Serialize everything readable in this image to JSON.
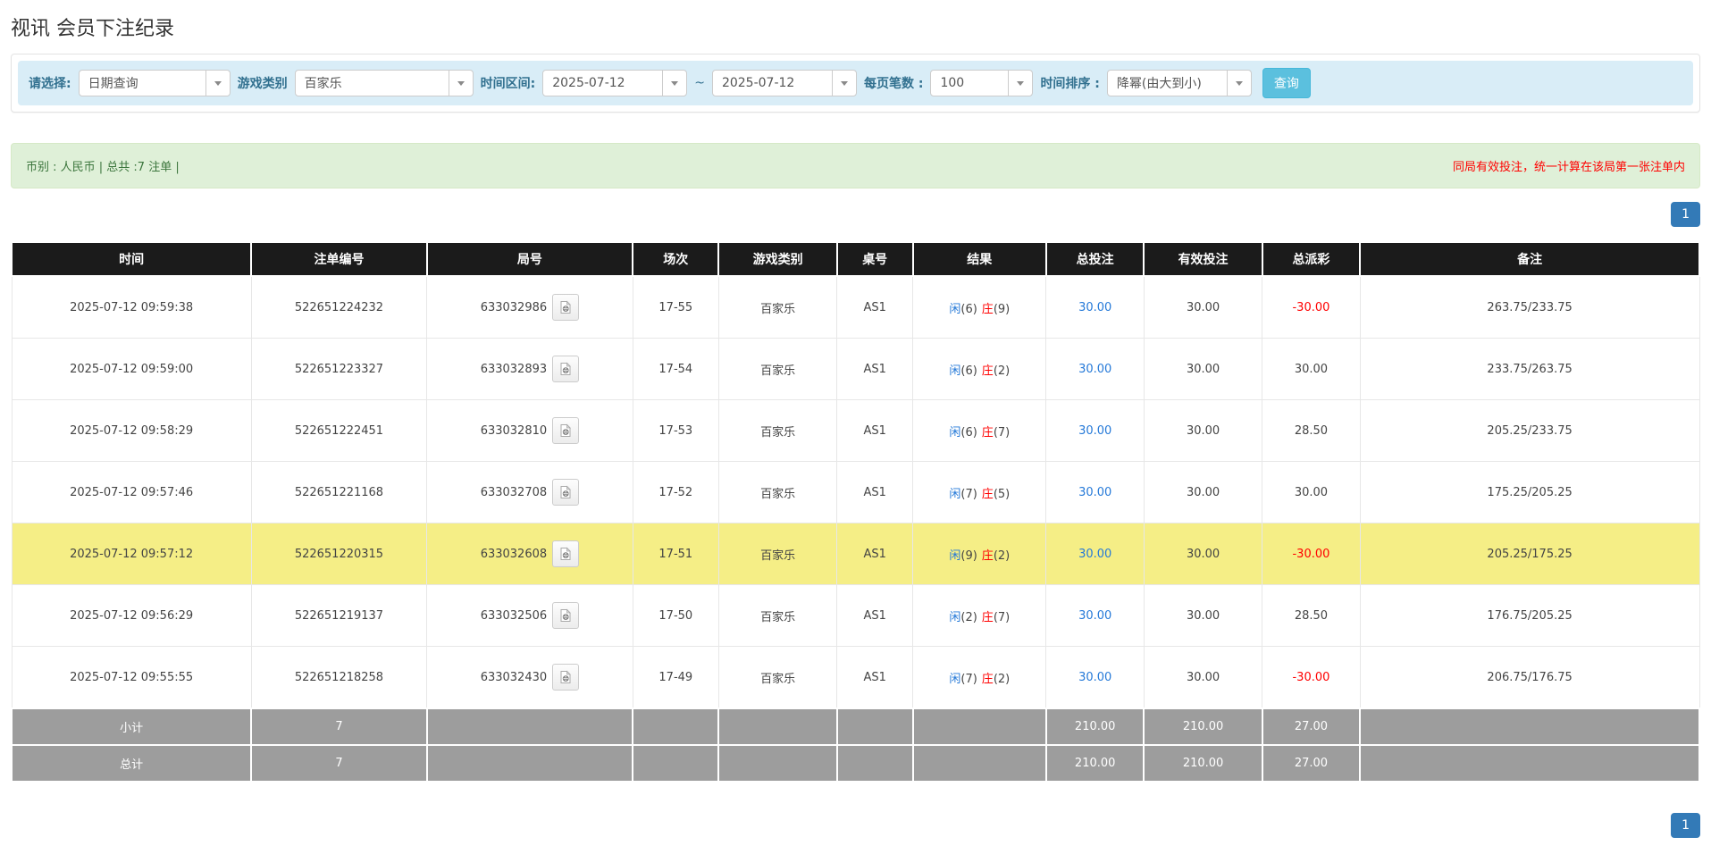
{
  "page": {
    "title": "视讯 会员下注纪录"
  },
  "filters": {
    "query_type_label": "请选择:",
    "query_type_value": "日期查询",
    "game_type_label": "游戏类别",
    "game_type_value": "百家乐",
    "date_range_label": "时间区间:",
    "date_from": "2025-07-12",
    "date_separator": "~",
    "date_to": "2025-07-12",
    "page_size_label": "每页笔数 :",
    "page_size_value": "100",
    "sort_label": "时间排序 :",
    "sort_value": "降幂(由大到小)",
    "search_button_label": "查询"
  },
  "summary": {
    "left_text": "币别 : 人民币 | 总共 :7 注单 |",
    "right_note": "同局有效投注，统一计算在该局第一张注单内"
  },
  "pagination": {
    "current_page": "1"
  },
  "table": {
    "headers": [
      "时间",
      "注单编号",
      "局号",
      "场次",
      "游戏类别",
      "桌号",
      "结果",
      "总投注",
      "有效投注",
      "总派彩",
      "备注"
    ],
    "rows": [
      {
        "time": "2025-07-12 09:59:38",
        "bet_id": "522651224232",
        "round_id": "633032986",
        "session": "17-55",
        "game_type": "百家乐",
        "table_no": "AS1",
        "result_player": "闲",
        "result_player_num": "(6)",
        "result_banker": "庄",
        "result_banker_num": "(9)",
        "total_bet": "30.00",
        "valid_bet": "30.00",
        "payout": "-30.00",
        "remark": "263.75/233.75",
        "highlighted": false
      },
      {
        "time": "2025-07-12 09:59:00",
        "bet_id": "522651223327",
        "round_id": "633032893",
        "session": "17-54",
        "game_type": "百家乐",
        "table_no": "AS1",
        "result_player": "闲",
        "result_player_num": "(6)",
        "result_banker": "庄",
        "result_banker_num": "(2)",
        "total_bet": "30.00",
        "valid_bet": "30.00",
        "payout": "30.00",
        "remark": "233.75/263.75",
        "highlighted": false
      },
      {
        "time": "2025-07-12 09:58:29",
        "bet_id": "522651222451",
        "round_id": "633032810",
        "session": "17-53",
        "game_type": "百家乐",
        "table_no": "AS1",
        "result_player": "闲",
        "result_player_num": "(6)",
        "result_banker": "庄",
        "result_banker_num": "(7)",
        "total_bet": "30.00",
        "valid_bet": "30.00",
        "payout": "28.50",
        "remark": "205.25/233.75",
        "highlighted": false
      },
      {
        "time": "2025-07-12 09:57:46",
        "bet_id": "522651221168",
        "round_id": "633032708",
        "session": "17-52",
        "game_type": "百家乐",
        "table_no": "AS1",
        "result_player": "闲",
        "result_player_num": "(7)",
        "result_banker": "庄",
        "result_banker_num": "(5)",
        "total_bet": "30.00",
        "valid_bet": "30.00",
        "payout": "30.00",
        "remark": "175.25/205.25",
        "highlighted": false
      },
      {
        "time": "2025-07-12 09:57:12",
        "bet_id": "522651220315",
        "round_id": "633032608",
        "session": "17-51",
        "game_type": "百家乐",
        "table_no": "AS1",
        "result_player": "闲",
        "result_player_num": "(9)",
        "result_banker": "庄",
        "result_banker_num": "(2)",
        "total_bet": "30.00",
        "valid_bet": "30.00",
        "payout": "-30.00",
        "remark": "205.25/175.25",
        "highlighted": true
      },
      {
        "time": "2025-07-12 09:56:29",
        "bet_id": "522651219137",
        "round_id": "633032506",
        "session": "17-50",
        "game_type": "百家乐",
        "table_no": "AS1",
        "result_player": "闲",
        "result_player_num": "(2)",
        "result_banker": "庄",
        "result_banker_num": "(7)",
        "total_bet": "30.00",
        "valid_bet": "30.00",
        "payout": "28.50",
        "remark": "176.75/205.25",
        "highlighted": false
      },
      {
        "time": "2025-07-12 09:55:55",
        "bet_id": "522651218258",
        "round_id": "633032430",
        "session": "17-49",
        "game_type": "百家乐",
        "table_no": "AS1",
        "result_player": "闲",
        "result_player_num": "(7)",
        "result_banker": "庄",
        "result_banker_num": "(2)",
        "total_bet": "30.00",
        "valid_bet": "30.00",
        "payout": "-30.00",
        "remark": "206.75/176.75",
        "highlighted": false
      }
    ],
    "footer_rows": [
      {
        "label": "小计",
        "count": "7",
        "total_bet": "210.00",
        "valid_bet": "210.00",
        "payout": "27.00"
      },
      {
        "label": "总计",
        "count": "7",
        "total_bet": "210.00",
        "valid_bet": "210.00",
        "payout": "27.00"
      }
    ]
  },
  "colors": {
    "accent_blue": "#5bc0de",
    "pagination_blue": "#337ab7",
    "highlight_yellow": "#f5ee86",
    "negative_red": "#ff0000",
    "link_blue": "#2579d8",
    "header_black": "#1b1b1b",
    "footer_gray": "#9d9d9d",
    "filter_bar_blue": "#d9edf7",
    "summary_green_bg": "#dff0d8"
  }
}
